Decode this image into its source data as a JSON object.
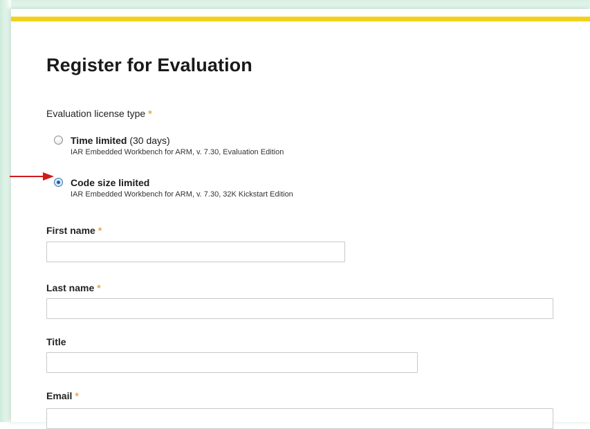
{
  "form": {
    "title": "Register for Evaluation",
    "license_type": {
      "label": "Evaluation license type",
      "required_mark": "*",
      "options": [
        {
          "name": "Time limited",
          "detail": "(30 days)",
          "description": "IAR Embedded Workbench for ARM, v. 7.30, Evaluation Edition",
          "selected": false
        },
        {
          "name": "Code size limited",
          "detail": "",
          "description": "IAR Embedded Workbench for ARM, v. 7.30, 32K Kickstart Edition",
          "selected": true
        }
      ]
    },
    "fields": {
      "first_name": {
        "label": "First name",
        "required_mark": "*",
        "value": ""
      },
      "last_name": {
        "label": "Last name",
        "required_mark": "*",
        "value": ""
      },
      "title": {
        "label": "Title",
        "value": ""
      },
      "email": {
        "label": "Email",
        "required_mark": "*",
        "value": ""
      }
    }
  },
  "colors": {
    "accent_bar": "#f3d11b",
    "required_mark": "#e8a64a",
    "annotation_arrow": "#d11b1b"
  }
}
